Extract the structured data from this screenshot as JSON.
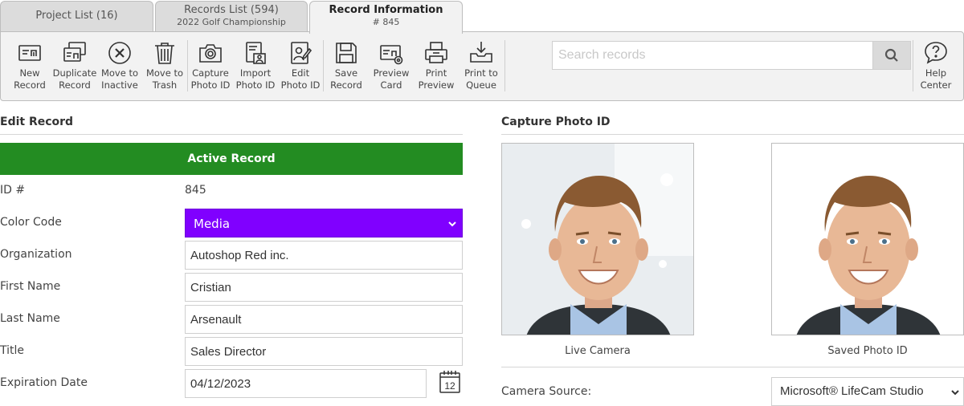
{
  "tabs": [
    {
      "title": "Project List (16)",
      "subtitle": ""
    },
    {
      "title": "Records List (594)",
      "subtitle": "2022 Golf Championship"
    },
    {
      "title": "Record Information",
      "subtitle": "# 845"
    }
  ],
  "toolbar": {
    "buttons": [
      {
        "line1": "New",
        "line2": "Record",
        "icon": "new-record-icon"
      },
      {
        "line1": "Duplicate",
        "line2": "Record",
        "icon": "duplicate-record-icon"
      },
      {
        "line1": "Move to",
        "line2": "Inactive",
        "icon": "circle-x-icon"
      },
      {
        "line1": "Move to",
        "line2": "Trash",
        "icon": "trash-icon"
      },
      {
        "line1": "Capture",
        "line2": "Photo ID",
        "icon": "camera-icon"
      },
      {
        "line1": "Import",
        "line2": "Photo ID",
        "icon": "import-photo-icon"
      },
      {
        "line1": "Edit",
        "line2": "Photo ID",
        "icon": "edit-photo-icon"
      },
      {
        "line1": "Save",
        "line2": "Record",
        "icon": "save-icon"
      },
      {
        "line1": "Preview",
        "line2": "Card",
        "icon": "preview-card-icon"
      },
      {
        "line1": "Print",
        "line2": "Preview",
        "icon": "printer-icon"
      },
      {
        "line1": "Print to",
        "line2": "Queue",
        "icon": "print-queue-icon"
      }
    ],
    "search_placeholder": "Search records",
    "help": {
      "line1": "Help",
      "line2": "Center"
    }
  },
  "edit_record": {
    "title": "Edit Record",
    "status": "Active Record",
    "status_color": "#238c22",
    "fields": {
      "id_label": "ID #",
      "id_value": "845",
      "color_code_label": "Color Code",
      "color_code_value": "Media",
      "color_code_color": "#8000ff",
      "organization_label": "Organization",
      "organization_value": "Autoshop Red inc.",
      "first_name_label": "First Name",
      "first_name_value": "Cristian",
      "last_name_label": "Last Name",
      "last_name_value": "Arsenault",
      "title_label": "Title",
      "title_value": "Sales Director",
      "expiration_label": "Expiration Date",
      "expiration_value": "04/12/2023",
      "calendar_day": "12"
    }
  },
  "capture": {
    "title": "Capture Photo ID",
    "live_caption": "Live Camera",
    "saved_caption": "Saved Photo ID",
    "camera_source_label": "Camera Source:",
    "camera_source_value": "Microsoft® LifeCam Studio"
  }
}
